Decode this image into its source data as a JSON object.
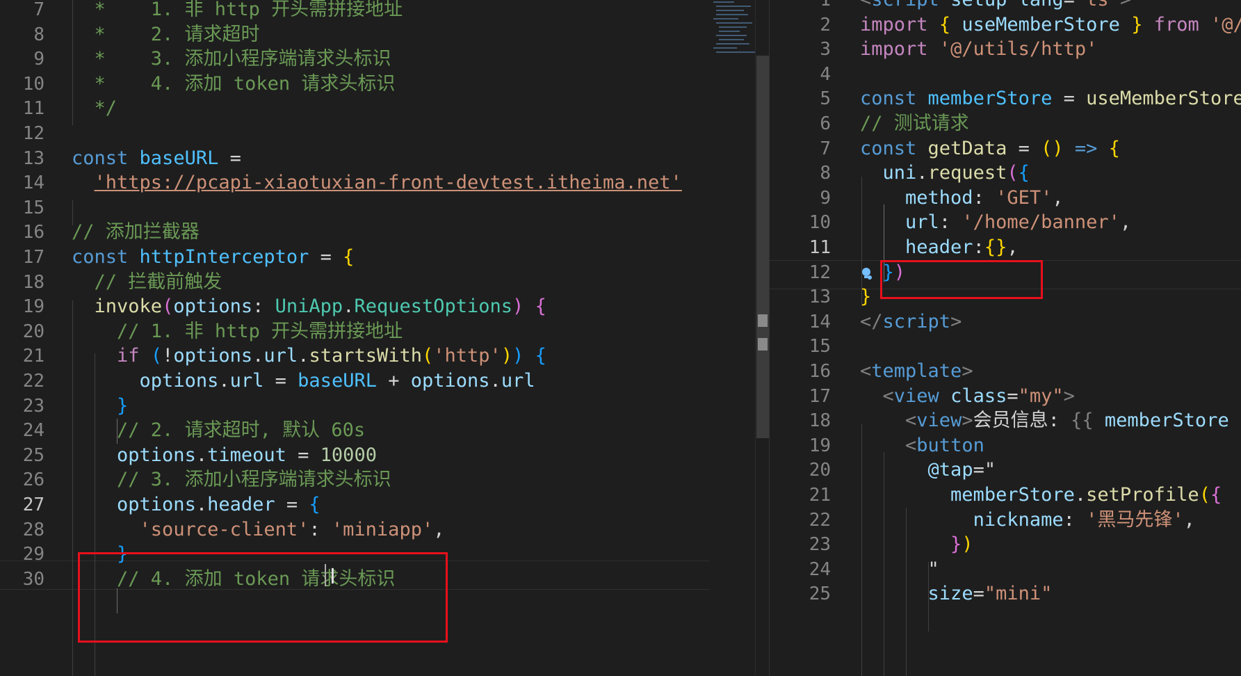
{
  "editor": {
    "left_pane": {
      "lines": [
        {
          "num": "7",
          "tokens": [
            {
              "t": "  *    1. 非 http 开头需拼接地址",
              "c": "cm"
            }
          ]
        },
        {
          "num": "8",
          "tokens": [
            {
              "t": "  *    2. 请求超时",
              "c": "cm"
            }
          ]
        },
        {
          "num": "9",
          "tokens": [
            {
              "t": "  *    3. 添加小程序端请求头标识",
              "c": "cm"
            }
          ]
        },
        {
          "num": "10",
          "tokens": [
            {
              "t": "  *    4. 添加 token 请求头标识",
              "c": "cm"
            }
          ]
        },
        {
          "num": "11",
          "tokens": [
            {
              "t": "  */",
              "c": "cm"
            }
          ]
        },
        {
          "num": "12",
          "tokens": []
        },
        {
          "num": "13",
          "tokens": [
            {
              "t": "const ",
              "c": "kw"
            },
            {
              "t": "baseURL",
              "c": "cn"
            },
            {
              "t": " =",
              "c": "pn"
            }
          ]
        },
        {
          "num": "14",
          "tokens": [
            {
              "t": "  "
            },
            {
              "t": "'https://pcapi-xiaotuxian-front-devtest.itheima.net'",
              "c": "st url"
            }
          ]
        },
        {
          "num": "15",
          "tokens": []
        },
        {
          "num": "16",
          "tokens": [
            {
              "t": "// 添加拦截器",
              "c": "cm"
            }
          ]
        },
        {
          "num": "17",
          "tokens": [
            {
              "t": "const ",
              "c": "kw"
            },
            {
              "t": "httpInterceptor",
              "c": "cn"
            },
            {
              "t": " = ",
              "c": "pn"
            },
            {
              "t": "{",
              "c": "b1"
            }
          ]
        },
        {
          "num": "18",
          "tokens": [
            {
              "t": "  "
            },
            {
              "t": "// 拦截前触发",
              "c": "cm"
            }
          ]
        },
        {
          "num": "19",
          "tokens": [
            {
              "t": "  "
            },
            {
              "t": "invoke",
              "c": "fn"
            },
            {
              "t": "(",
              "c": "b2"
            },
            {
              "t": "options",
              "c": "vr"
            },
            {
              "t": ": ",
              "c": "pn"
            },
            {
              "t": "UniApp",
              "c": "ty"
            },
            {
              "t": ".",
              "c": "pn"
            },
            {
              "t": "RequestOptions",
              "c": "ty"
            },
            {
              "t": ")",
              "c": "b2"
            },
            {
              "t": " "
            },
            {
              "t": "{",
              "c": "b2"
            }
          ]
        },
        {
          "num": "20",
          "tokens": [
            {
              "t": "    "
            },
            {
              "t": "// 1. 非 http 开头需拼接地址",
              "c": "cm"
            }
          ]
        },
        {
          "num": "21",
          "tokens": [
            {
              "t": "    "
            },
            {
              "t": "if",
              "c": "ctl"
            },
            {
              "t": " "
            },
            {
              "t": "(",
              "c": "b3"
            },
            {
              "t": "!",
              "c": "pn"
            },
            {
              "t": "options",
              "c": "vr"
            },
            {
              "t": ".",
              "c": "pn"
            },
            {
              "t": "url",
              "c": "vr"
            },
            {
              "t": ".",
              "c": "pn"
            },
            {
              "t": "startsWith",
              "c": "fn"
            },
            {
              "t": "(",
              "c": "b1"
            },
            {
              "t": "'http'",
              "c": "st"
            },
            {
              "t": ")",
              "c": "b1"
            },
            {
              "t": ")",
              "c": "b3"
            },
            {
              "t": " "
            },
            {
              "t": "{",
              "c": "b3"
            }
          ]
        },
        {
          "num": "22",
          "tokens": [
            {
              "t": "      "
            },
            {
              "t": "options",
              "c": "vr"
            },
            {
              "t": ".",
              "c": "pn"
            },
            {
              "t": "url",
              "c": "vr"
            },
            {
              "t": " = ",
              "c": "pn"
            },
            {
              "t": "baseURL",
              "c": "cn"
            },
            {
              "t": " + ",
              "c": "pn"
            },
            {
              "t": "options",
              "c": "vr"
            },
            {
              "t": ".",
              "c": "pn"
            },
            {
              "t": "url",
              "c": "vr"
            }
          ]
        },
        {
          "num": "23",
          "tokens": [
            {
              "t": "    "
            },
            {
              "t": "}",
              "c": "b3"
            }
          ]
        },
        {
          "num": "24",
          "tokens": [
            {
              "t": "    "
            },
            {
              "t": "// 2. 请求超时, 默认 60s",
              "c": "cm"
            }
          ]
        },
        {
          "num": "25",
          "tokens": [
            {
              "t": "    "
            },
            {
              "t": "options",
              "c": "vr"
            },
            {
              "t": ".",
              "c": "pn"
            },
            {
              "t": "timeout",
              "c": "vr"
            },
            {
              "t": " = ",
              "c": "pn"
            },
            {
              "t": "10000",
              "c": "nm"
            }
          ]
        },
        {
          "num": "26",
          "tokens": [
            {
              "t": "    "
            },
            {
              "t": "// 3. 添加小程序端请求头标识",
              "c": "cm"
            }
          ]
        },
        {
          "num": "27",
          "active": true,
          "tokens": [
            {
              "t": "    "
            },
            {
              "t": "options",
              "c": "vr"
            },
            {
              "t": ".",
              "c": "pn"
            },
            {
              "t": "header",
              "c": "vr"
            },
            {
              "t": " = ",
              "c": "pn"
            },
            {
              "t": "{",
              "c": "b3"
            }
          ]
        },
        {
          "num": "28",
          "tokens": [
            {
              "t": "      "
            },
            {
              "t": "'source-client'",
              "c": "st"
            },
            {
              "t": ": ",
              "c": "pn"
            },
            {
              "t": "'miniapp'",
              "c": "st"
            },
            {
              "t": ",",
              "c": "pn"
            }
          ]
        },
        {
          "num": "29",
          "tokens": [
            {
              "t": "    "
            },
            {
              "t": "}",
              "c": "b3"
            }
          ]
        },
        {
          "num": "30",
          "tokens": [
            {
              "t": "    "
            },
            {
              "t": "// 4. 添加 token 请求头标识",
              "c": "cm"
            }
          ]
        }
      ]
    },
    "right_pane": {
      "lines": [
        {
          "num": "1",
          "tokens": [
            {
              "t": "<",
              "c": "tg"
            },
            {
              "t": "script",
              "c": "tn"
            },
            {
              "t": " "
            },
            {
              "t": "setup",
              "c": "at"
            },
            {
              "t": " "
            },
            {
              "t": "lang",
              "c": "at"
            },
            {
              "t": "=",
              "c": "pn"
            },
            {
              "t": "\"ts\"",
              "c": "st"
            },
            {
              "t": ">",
              "c": "tg"
            }
          ]
        },
        {
          "num": "2",
          "tokens": [
            {
              "t": "import",
              "c": "ctl"
            },
            {
              "t": " "
            },
            {
              "t": "{",
              "c": "b1"
            },
            {
              "t": " "
            },
            {
              "t": "useMemberStore",
              "c": "vr"
            },
            {
              "t": " "
            },
            {
              "t": "}",
              "c": "b1"
            },
            {
              "t": " "
            },
            {
              "t": "from",
              "c": "ctl"
            },
            {
              "t": " "
            },
            {
              "t": "'@/stores'",
              "c": "st"
            }
          ]
        },
        {
          "num": "3",
          "tokens": [
            {
              "t": "import",
              "c": "ctl"
            },
            {
              "t": " "
            },
            {
              "t": "'@/utils/http'",
              "c": "st"
            }
          ]
        },
        {
          "num": "4",
          "tokens": []
        },
        {
          "num": "5",
          "tokens": [
            {
              "t": "const ",
              "c": "kw"
            },
            {
              "t": "memberStore",
              "c": "cn"
            },
            {
              "t": " = ",
              "c": "pn"
            },
            {
              "t": "useMemberStore",
              "c": "fn"
            },
            {
              "t": "()",
              "c": "b1"
            }
          ]
        },
        {
          "num": "6",
          "tokens": [
            {
              "t": "// 测试请求",
              "c": "cm"
            }
          ]
        },
        {
          "num": "7",
          "tokens": [
            {
              "t": "const ",
              "c": "kw"
            },
            {
              "t": "getData",
              "c": "fn"
            },
            {
              "t": " = ",
              "c": "pn"
            },
            {
              "t": "()",
              "c": "b1"
            },
            {
              "t": " "
            },
            {
              "t": "=>",
              "c": "kw"
            },
            {
              "t": " "
            },
            {
              "t": "{",
              "c": "b1"
            }
          ]
        },
        {
          "num": "8",
          "tokens": [
            {
              "t": "  "
            },
            {
              "t": "uni",
              "c": "vr"
            },
            {
              "t": ".",
              "c": "pn"
            },
            {
              "t": "request",
              "c": "fn"
            },
            {
              "t": "(",
              "c": "b2"
            },
            {
              "t": "{",
              "c": "b3"
            }
          ]
        },
        {
          "num": "9",
          "tokens": [
            {
              "t": "    "
            },
            {
              "t": "method",
              "c": "vr"
            },
            {
              "t": ": ",
              "c": "pn"
            },
            {
              "t": "'GET'",
              "c": "st"
            },
            {
              "t": ",",
              "c": "pn"
            }
          ]
        },
        {
          "num": "10",
          "tokens": [
            {
              "t": "    "
            },
            {
              "t": "url",
              "c": "vr"
            },
            {
              "t": ": ",
              "c": "pn"
            },
            {
              "t": "'/home/banner'",
              "c": "st"
            },
            {
              "t": ",",
              "c": "pn"
            }
          ]
        },
        {
          "num": "11",
          "active": true,
          "tokens": [
            {
              "t": "    "
            },
            {
              "t": "header",
              "c": "vr"
            },
            {
              "t": ":",
              "c": "pn"
            },
            {
              "t": "{}",
              "c": "b1"
            },
            {
              "t": ",",
              "c": "pn"
            }
          ]
        },
        {
          "num": "12",
          "tokens": [
            {
              "t": "  "
            },
            {
              "t": "}",
              "c": "b3"
            },
            {
              "t": ")",
              "c": "b2"
            }
          ]
        },
        {
          "num": "13",
          "tokens": [
            {
              "t": "}",
              "c": "b1"
            }
          ]
        },
        {
          "num": "14",
          "tokens": [
            {
              "t": "</",
              "c": "tg"
            },
            {
              "t": "script",
              "c": "tn"
            },
            {
              "t": ">",
              "c": "tg"
            }
          ]
        },
        {
          "num": "15",
          "tokens": []
        },
        {
          "num": "16",
          "tokens": [
            {
              "t": "<",
              "c": "tg"
            },
            {
              "t": "template",
              "c": "tn"
            },
            {
              "t": ">",
              "c": "tg"
            }
          ]
        },
        {
          "num": "17",
          "tokens": [
            {
              "t": "  "
            },
            {
              "t": "<",
              "c": "tg"
            },
            {
              "t": "view",
              "c": "tn"
            },
            {
              "t": " "
            },
            {
              "t": "class",
              "c": "at"
            },
            {
              "t": "=",
              "c": "pn"
            },
            {
              "t": "\"my\"",
              "c": "st"
            },
            {
              "t": ">",
              "c": "tg"
            }
          ]
        },
        {
          "num": "18",
          "tokens": [
            {
              "t": "    "
            },
            {
              "t": "<",
              "c": "tg"
            },
            {
              "t": "view",
              "c": "tn"
            },
            {
              "t": ">",
              "c": "tg"
            },
            {
              "t": "会员信息: ",
              "c": "pn"
            },
            {
              "t": "{{",
              "c": "tg"
            },
            {
              "t": " "
            },
            {
              "t": "memberStore",
              "c": "vr"
            }
          ]
        },
        {
          "num": "19",
          "tokens": [
            {
              "t": "    "
            },
            {
              "t": "<",
              "c": "tg"
            },
            {
              "t": "button",
              "c": "tn"
            }
          ]
        },
        {
          "num": "20",
          "tokens": [
            {
              "t": "      "
            },
            {
              "t": "@tap",
              "c": "at"
            },
            {
              "t": "=\"",
              "c": "pn"
            }
          ]
        },
        {
          "num": "21",
          "tokens": [
            {
              "t": "        "
            },
            {
              "t": "memberStore",
              "c": "vr"
            },
            {
              "t": ".",
              "c": "pn"
            },
            {
              "t": "setProfile",
              "c": "fn"
            },
            {
              "t": "(",
              "c": "b1"
            },
            {
              "t": "{",
              "c": "b2"
            }
          ]
        },
        {
          "num": "22",
          "tokens": [
            {
              "t": "          "
            },
            {
              "t": "nickname",
              "c": "vr"
            },
            {
              "t": ": ",
              "c": "pn"
            },
            {
              "t": "'黑马先锋'",
              "c": "st"
            },
            {
              "t": ",",
              "c": "pn"
            }
          ]
        },
        {
          "num": "23",
          "tokens": [
            {
              "t": "        "
            },
            {
              "t": "}",
              "c": "b2"
            },
            {
              "t": ")",
              "c": "b1"
            }
          ]
        },
        {
          "num": "24",
          "tokens": [
            {
              "t": "      "
            },
            {
              "t": "\"",
              "c": "pn"
            }
          ]
        },
        {
          "num": "25",
          "tokens": [
            {
              "t": "      "
            },
            {
              "t": "size",
              "c": "at"
            },
            {
              "t": "=",
              "c": "pn"
            },
            {
              "t": "\"mini\"",
              "c": "st"
            }
          ]
        }
      ]
    }
  },
  "colors": {
    "background": "#1e1e1e",
    "annotation_box": "#e8101c",
    "line_number": "#858585"
  }
}
